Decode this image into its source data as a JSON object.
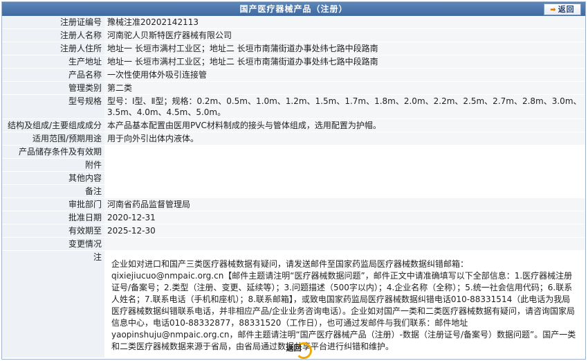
{
  "header": {
    "title": "国产医疗器械产品（注册）",
    "back_label": "返回"
  },
  "rows": [
    {
      "label": "注册证编号",
      "value": "豫械注准20202142113"
    },
    {
      "label": "注册人名称",
      "value": "河南驼人贝斯特医疗器械有限公司"
    },
    {
      "label": "注册人住所",
      "value": "地址一 长垣市满村工业区；地址二 长垣市南蒲街道办事处纬七路中段路南"
    },
    {
      "label": "生产地址",
      "value": "地址一 长垣市满村工业区；地址二 长垣市南蒲街道办事处纬七路中段路南"
    },
    {
      "label": "产品名称",
      "value": "一次性使用体外吸引连接管"
    },
    {
      "label": "管理类别",
      "value": "第二类"
    },
    {
      "label": "型号规格",
      "value": "型号：Ⅰ型、Ⅱ型；规格：0.2m、0.5m、1.0m、1.2m、1.5m、1.7m、1.8m、2.0m、2.2m、2.5m、2.7m、2.8m、3.0m、3.5m、4.0m、4.5m、5.0m。"
    },
    {
      "label": "结构及组成/主要组成成分",
      "value": "本产品基本配置由医用PVC材料制成的接头与管体组成，选用配置为护帽。"
    },
    {
      "label": "适用范围/预期用途",
      "value": "用于向外引出体内液体。"
    },
    {
      "label": "产品储存条件及有效期",
      "value": ""
    },
    {
      "label": "附件",
      "value": ""
    },
    {
      "label": "其他内容",
      "value": ""
    },
    {
      "label": "备注",
      "value": ""
    },
    {
      "label": "审批部门",
      "value": "河南省药品监督管理局"
    },
    {
      "label": "批准日期",
      "value": "2020-12-31"
    },
    {
      "label": "有效期至",
      "value": "2025-12-30"
    },
    {
      "label": "变更情况",
      "value": ""
    }
  ],
  "note": {
    "label": "注",
    "text": "企业如对进口和国产三类医疗器械数据有疑问，请发送邮件至国家药监局医疗器械数据纠错邮箱：qixiejiucuo@nmpaic.org.cn【邮件主题请注明“医疗器械数据问题”，邮件正文中请准确填写以下全部信息：1.医疗器械注册证号/备案号；2.类型（注册、变更、延续等）；3.问题描述（500字以内）；4.企业名称（全称）；5.统一社会信用代码；6.联系人姓名；7.联系电话（手机和座机）；8.联系邮箱】，或致电国家药监局医疗器械数据纠错电话010-88331514（此电话为我局医疗器械数据纠错联系电话，并非相应产品/企业业务咨询电话）。企业如对国产一类和二类医疗器械数据有疑问，请咨询国家局信息中心，电话010-88332877，88331520（工作日），也可通过发邮件与我们联系：邮件地址yaopinshuju@nmpaic.org.cn，邮件主题请注明“国产医疗器械产品（注册）-数据（注册证号/备案号）数据问题”。国产一类和二类医疗器械数据来源于省局，由省局通过数据共享平台进行纠错和维护。"
  },
  "footer": {
    "back_label": "返回"
  }
}
